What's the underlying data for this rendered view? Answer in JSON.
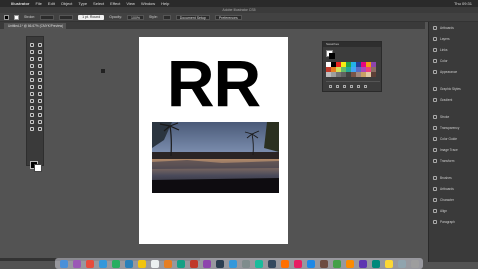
{
  "menubar": {
    "items": [
      "Illustrator",
      "File",
      "Edit",
      "Object",
      "Type",
      "Select",
      "Effect",
      "View",
      "Window",
      "Help"
    ],
    "clock": "Thu 09:31"
  },
  "window": {
    "title": "Adobe Illustrator CS5"
  },
  "control": {
    "stroke_label": "Stroke:",
    "pt_label": "1 pt. Round",
    "opacity_label": "Opacity:",
    "opacity_value": "100%",
    "style_label": "Style:",
    "doc_setup": "Document Setup",
    "prefs": "Preferences"
  },
  "tab": {
    "label": "Untitled-1* @ 66.67% (CMYK/Preview)"
  },
  "artboard": {
    "text": "RR"
  },
  "swatches_panel": {
    "title": "Swatches"
  },
  "right_panels": [
    "Artboards",
    "Layers",
    "Links",
    "Color",
    "Appearance",
    "Graphic Styles",
    "Gradient",
    "Stroke",
    "Transparency",
    "Color Guide",
    "Image Trace",
    "Transform",
    "Brushes",
    "Artboards",
    "Character",
    "Align",
    "Paragraph"
  ],
  "colors": {
    "bg": "#535353",
    "panel": "#3a3a3a",
    "menubar": "#2a2a2a"
  }
}
